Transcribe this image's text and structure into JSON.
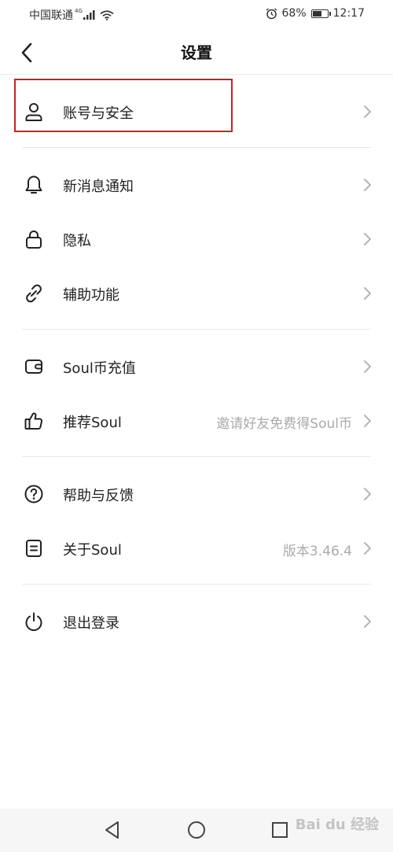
{
  "status": {
    "carrier": "中国联通",
    "network": "4G",
    "alarm_icon": "alarm-icon",
    "battery": "68%",
    "battery_level": 0.68,
    "time": "12:17"
  },
  "header": {
    "title": "设置"
  },
  "settings": {
    "account": {
      "label": "账号与安全",
      "icon": "user-icon"
    },
    "notifications": {
      "label": "新消息通知",
      "icon": "bell-icon"
    },
    "privacy": {
      "label": "隐私",
      "icon": "lock-icon"
    },
    "accessibility": {
      "label": "辅助功能",
      "icon": "link-icon"
    },
    "recharge": {
      "label": "Soul币充值",
      "icon": "wallet-icon"
    },
    "recommend": {
      "label": "推荐Soul",
      "value": "邀请好友免费得Soul币",
      "icon": "thumbs-up-icon"
    },
    "help": {
      "label": "帮助与反馈",
      "icon": "help-icon"
    },
    "about": {
      "label": "关于Soul",
      "value": "版本3.46.4",
      "icon": "document-icon"
    },
    "logout": {
      "label": "退出登录",
      "icon": "power-icon"
    }
  },
  "colors": {
    "highlight": "#c8202b",
    "value_text": "#aaaaaa",
    "chevron": "#b5b5b5"
  },
  "watermark": {
    "text": "Bai du 经验"
  }
}
